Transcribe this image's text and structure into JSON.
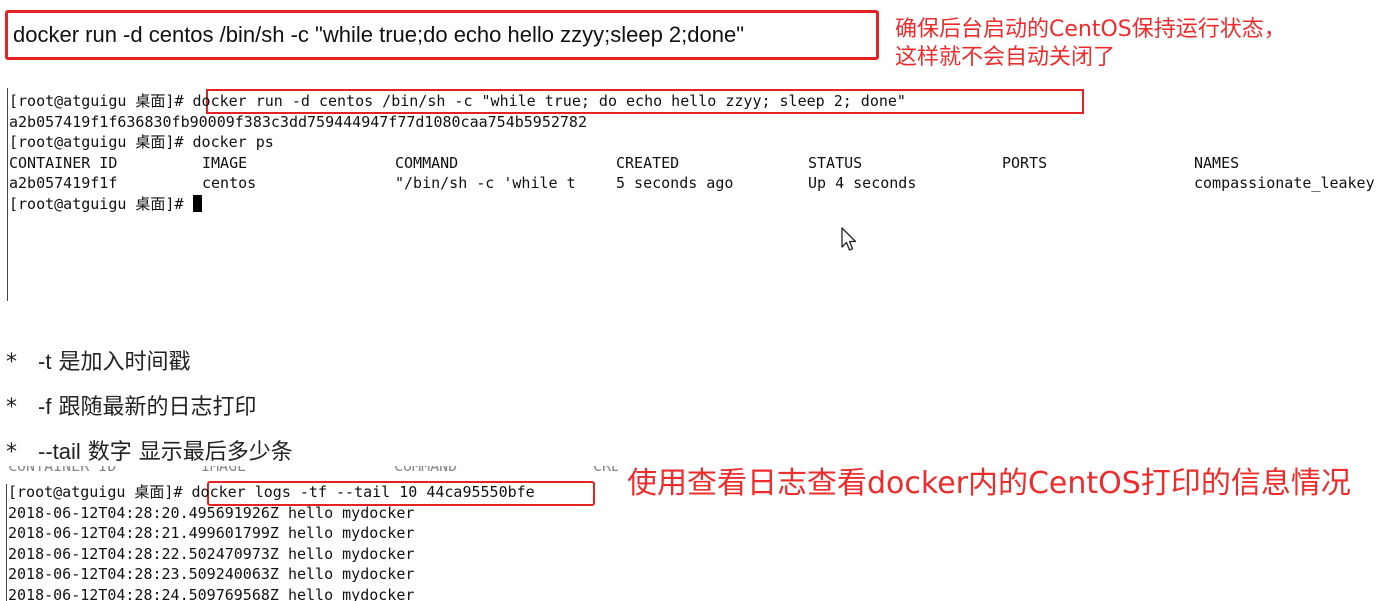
{
  "top": {
    "command": "docker run -d centos /bin/sh -c \"while true;do echo hello zzyy;sleep 2;done\"",
    "note_line1": "确保后台启动的CentOS保持运行状态，",
    "note_line2": "这样就不会自动关闭了"
  },
  "terminal1": {
    "prompt": "[root@atguigu 桌面]# ",
    "command": "docker run -d centos /bin/sh -c \"while true; do echo hello zzyy; sleep 2; done\"",
    "container_hash": "a2b057419f1f636830fb90009f383c3dd759444947f77d1080caa754b5952782",
    "ps_prompt": "[root@atguigu 桌面]# ",
    "ps_command": "docker ps",
    "ps_headers": [
      "CONTAINER ID",
      "IMAGE",
      "COMMAND",
      "CREATED",
      "STATUS",
      "PORTS",
      "NAMES"
    ],
    "ps_row": [
      "a2b057419f1f",
      "centos",
      "\"/bin/sh -c 'while t",
      "5 seconds ago",
      "Up 4 seconds",
      "",
      "compassionate_leakey"
    ],
    "last_prompt": "[root@atguigu 桌面]# "
  },
  "bullets": [
    {
      "star": "*",
      "flag": "-t",
      "desc": "是加入时间戳"
    },
    {
      "star": "*",
      "flag": "-f",
      "desc": "跟随最新的日志打印"
    },
    {
      "star": "*",
      "flag": "--tail",
      "desc": "数字 显示最后多少条"
    }
  ],
  "terminal2": {
    "ghost_headers": [
      "CONTAINER ID",
      "IMAGE",
      "COMMAND",
      "CREA"
    ],
    "prompt": "[root@atguigu 桌面]# ",
    "command": "docker logs -tf --tail 10 44ca95550bfe",
    "log_lines": [
      "2018-06-12T04:28:20.495691926Z hello mydocker",
      "2018-06-12T04:28:21.499601799Z hello mydocker",
      "2018-06-12T04:28:22.502470973Z hello mydocker",
      "2018-06-12T04:28:23.509240063Z hello mydocker",
      "2018-06-12T04:28:24.509769568Z hello mydocker"
    ],
    "note": "使用查看日志查看docker内的CentOS打印的信息情况"
  },
  "colors": {
    "annotation": "#ee2c2c",
    "box": "#e52222"
  },
  "icons": [
    "mouse-pointer-icon",
    "terminal-cursor"
  ]
}
